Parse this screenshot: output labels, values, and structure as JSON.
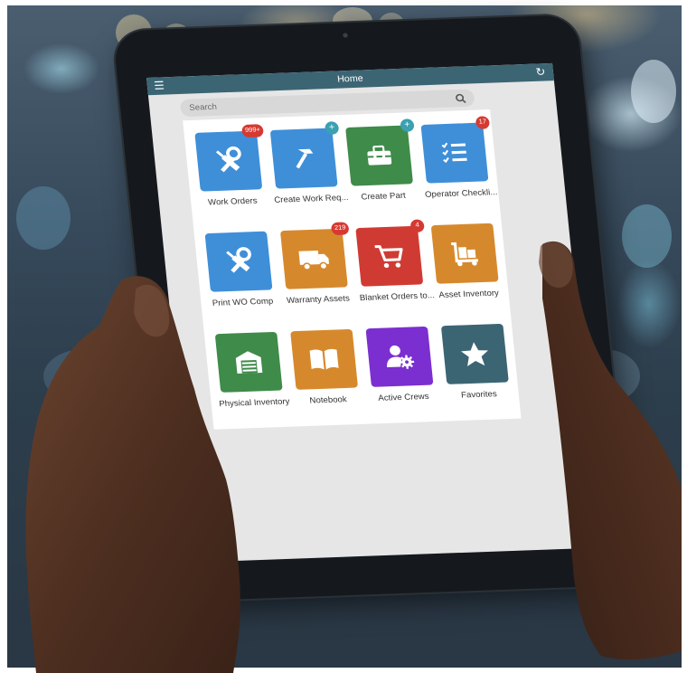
{
  "header": {
    "menu_icon": "☰",
    "title": "Home",
    "refresh_icon": "↻"
  },
  "search": {
    "placeholder": "Search"
  },
  "colors": {
    "header": "#3c6574",
    "blue": "#3e8fd8",
    "green": "#3f8b4a",
    "orange": "#d6892c",
    "red": "#cf3b33",
    "purple": "#7b2fd0",
    "teal": "#3c6574",
    "badge_red": "#d53a32",
    "badge_plus": "#3aa0b2"
  },
  "tiles": [
    {
      "label": "Work Orders",
      "badge": "999+",
      "icon": "tools-icon",
      "color": "blue"
    },
    {
      "label": "Create Work Req...",
      "badge": "+",
      "icon": "hammer-icon",
      "color": "blue"
    },
    {
      "label": "Create Part",
      "badge": "+",
      "icon": "toolbox-icon",
      "color": "green"
    },
    {
      "label": "Operator Checkli...",
      "badge": "17",
      "icon": "checklist-icon",
      "color": "blue"
    },
    {
      "label": "Print WO Comp",
      "badge": "",
      "icon": "tools-icon",
      "color": "blue"
    },
    {
      "label": "Warranty Assets",
      "badge": "219",
      "icon": "truck-icon",
      "color": "orange"
    },
    {
      "label": "Blanket Orders to...",
      "badge": "4",
      "icon": "cart-icon",
      "color": "red"
    },
    {
      "label": "Asset Inventory",
      "badge": "",
      "icon": "dolly-icon",
      "color": "orange"
    },
    {
      "label": "Physical Inventory",
      "badge": "",
      "icon": "warehouse-icon",
      "color": "green"
    },
    {
      "label": "Notebook",
      "badge": "",
      "icon": "book-icon",
      "color": "orange"
    },
    {
      "label": "Active Crews",
      "badge": "",
      "icon": "user-gear-icon",
      "color": "purple"
    },
    {
      "label": "Favorites",
      "badge": "",
      "icon": "star-icon",
      "color": "teal"
    }
  ]
}
